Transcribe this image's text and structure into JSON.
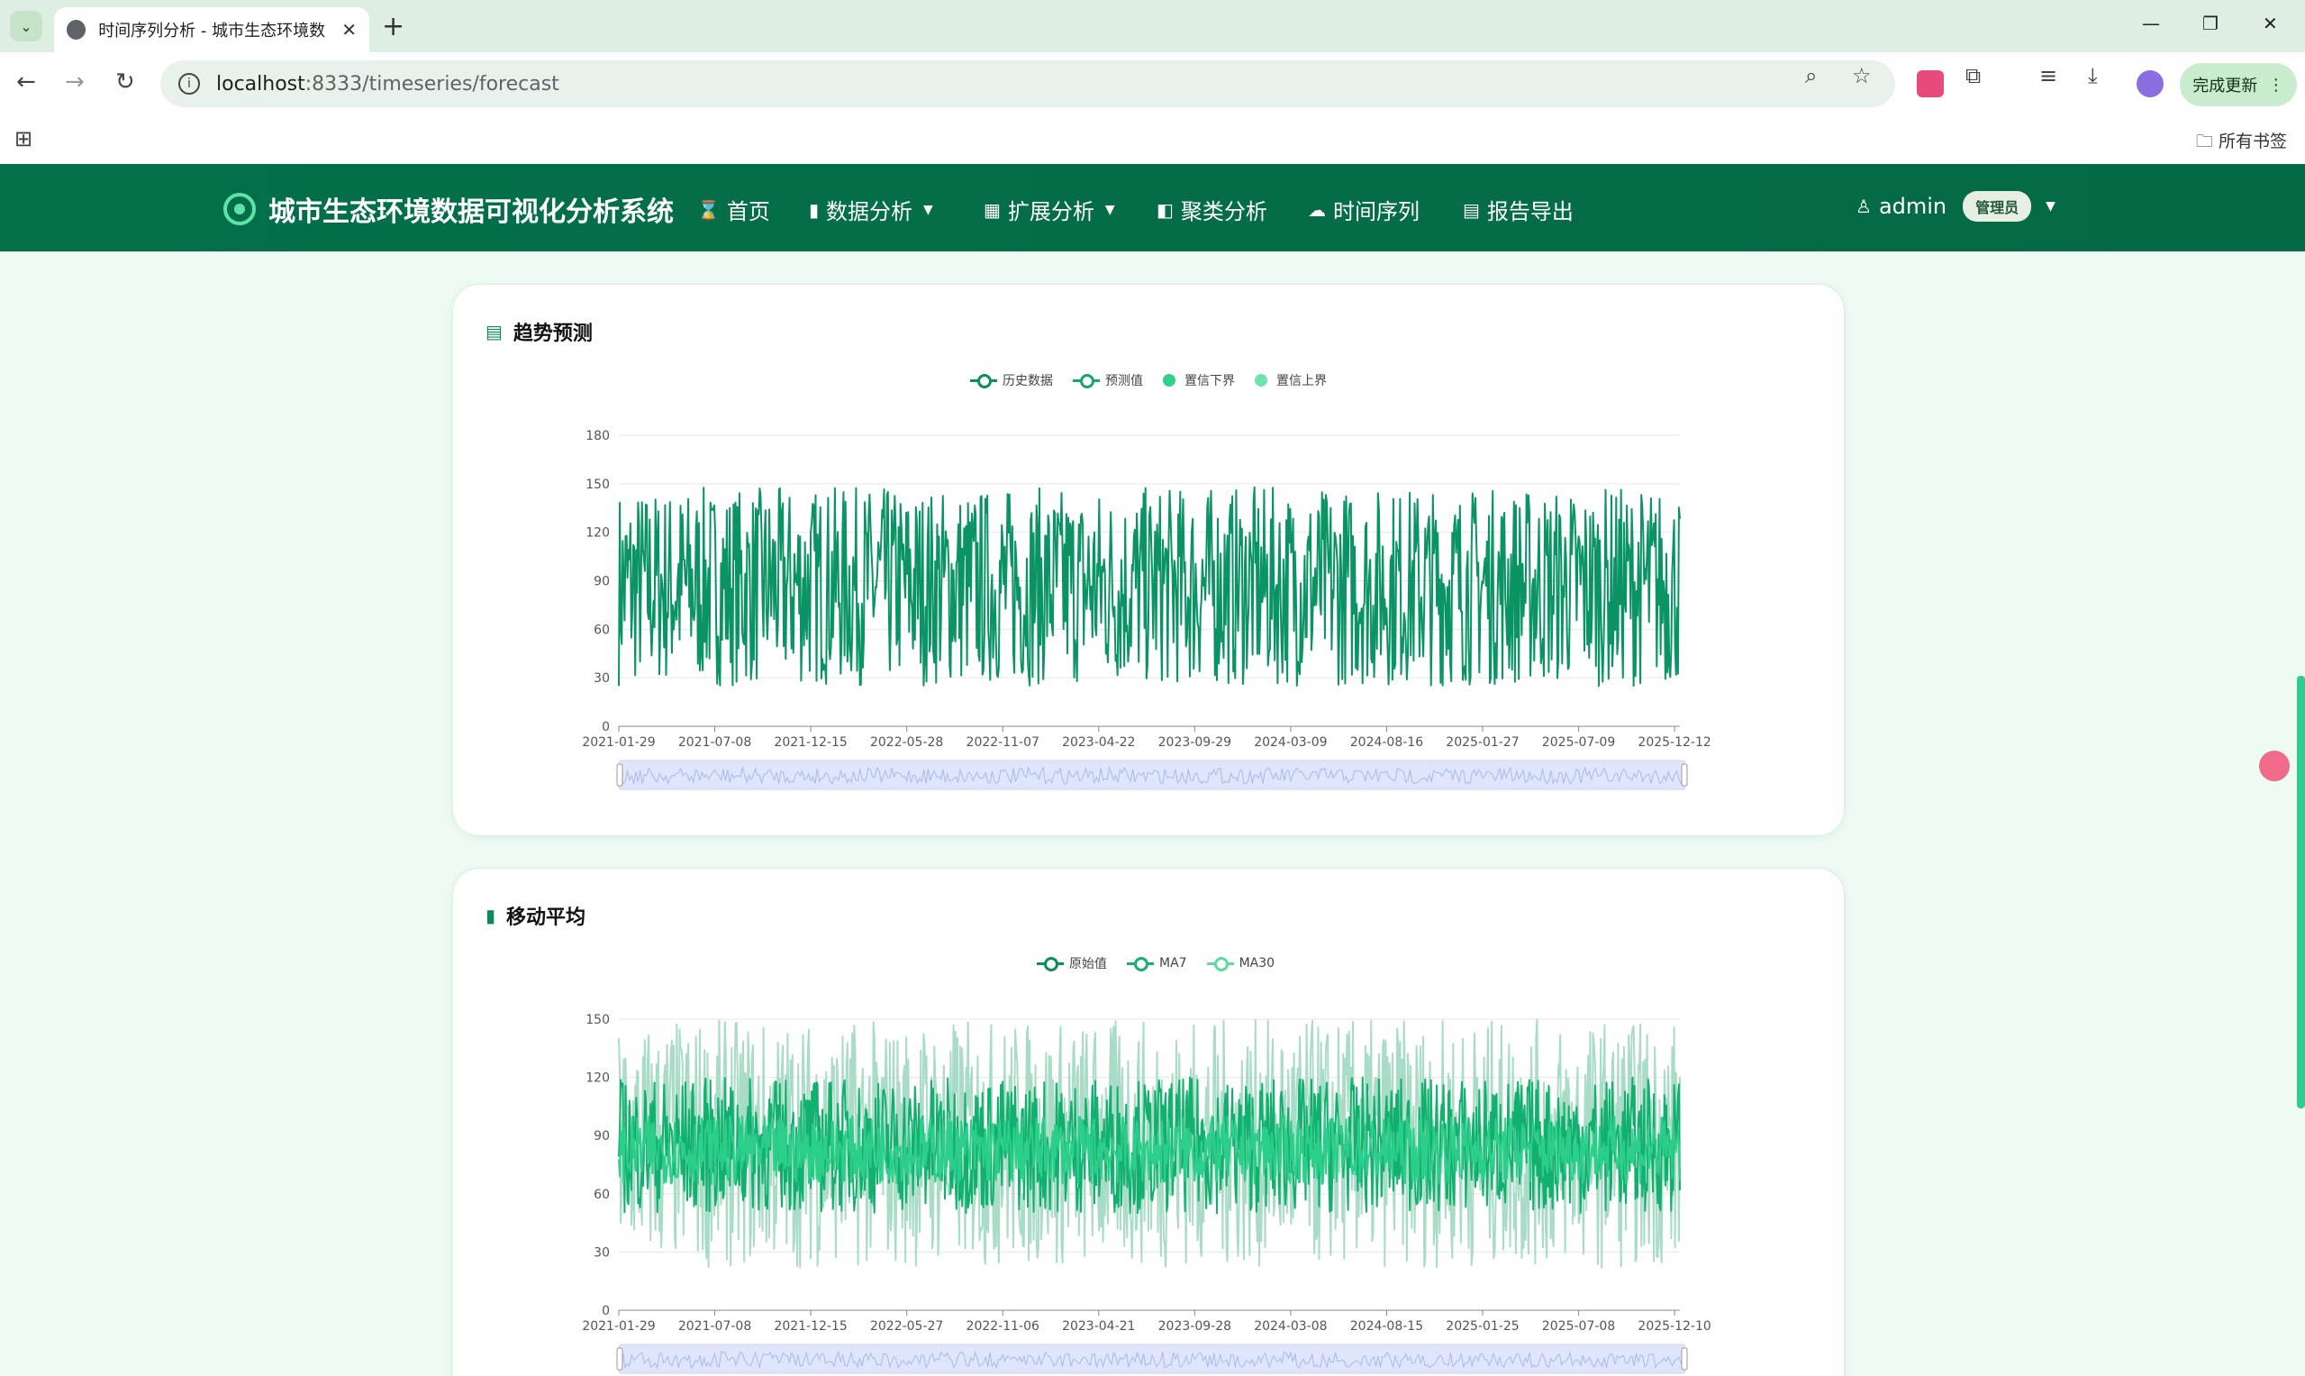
{
  "browser": {
    "tab_title": "时间序列分析 - 城市生态环境数",
    "url_host": "localhost",
    "url_rest": ":8333/timeseries/forecast",
    "update_label": "完成更新",
    "bookmarks_label": "所有书签",
    "icons": [
      "tab-search-icon",
      "back-icon",
      "forward-icon",
      "reload-icon",
      "info-icon",
      "zoom-icon",
      "star-icon",
      "extensions-icon",
      "download-icon",
      "profile-icon",
      "apps-icon",
      "folder-icon"
    ]
  },
  "nav": {
    "brand": "城市生态环境数据可视化分析系统",
    "items": [
      {
        "label": "首页",
        "icon": "hourglass-icon",
        "dropdown": false
      },
      {
        "label": "数据分析",
        "icon": "bar-chart-icon",
        "dropdown": true
      },
      {
        "label": "扩展分析",
        "icon": "grid-icon",
        "dropdown": true
      },
      {
        "label": "聚类分析",
        "icon": "layout-icon",
        "dropdown": false
      },
      {
        "label": "时间序列",
        "icon": "cloud-icon",
        "dropdown": false
      },
      {
        "label": "报告导出",
        "icon": "document-icon",
        "dropdown": false
      }
    ],
    "user": "admin",
    "role": "管理员"
  },
  "cards": [
    {
      "title": "趋势预测",
      "icon": "table-icon",
      "legend": [
        {
          "label": "历史数据",
          "kind": "line",
          "color": "#0a8f5a"
        },
        {
          "label": "预测值",
          "kind": "line",
          "color": "#16a66a"
        },
        {
          "label": "置信下界",
          "kind": "dot",
          "color": "#2fcf8c"
        },
        {
          "label": "置信上界",
          "kind": "dot",
          "color": "#6fe2b0"
        }
      ]
    },
    {
      "title": "移动平均",
      "icon": "bar-chart-icon",
      "legend": [
        {
          "label": "原始值",
          "kind": "line",
          "color": "#0a8f5a"
        },
        {
          "label": "MA7",
          "kind": "line",
          "color": "#16b070"
        },
        {
          "label": "MA30",
          "kind": "line",
          "color": "#5fd8a4"
        }
      ]
    }
  ],
  "chart_data": [
    {
      "type": "line",
      "title": "趋势预测",
      "x_ticks": [
        "2021-01-29",
        "2021-07-08",
        "2021-12-15",
        "2022-05-28",
        "2022-11-07",
        "2023-04-22",
        "2023-09-29",
        "2024-03-09",
        "2024-08-16",
        "2025-01-27",
        "2025-07-09",
        "2025-12-12"
      ],
      "y_ticks": [
        0,
        30,
        60,
        90,
        120,
        150,
        180
      ],
      "ylim": [
        0,
        180
      ],
      "series": [
        {
          "name": "历史数据",
          "band": [
            25,
            148
          ],
          "color": "#0a9463"
        }
      ],
      "data_zoom": true
    },
    {
      "type": "line",
      "title": "移动平均",
      "x_ticks": [
        "2021-01-29",
        "2021-07-08",
        "2021-12-15",
        "2022-05-27",
        "2022-11-06",
        "2023-04-21",
        "2023-09-28",
        "2024-03-08",
        "2024-08-15",
        "2025-01-25",
        "2025-07-08",
        "2025-12-10"
      ],
      "y_ticks": [
        0,
        30,
        60,
        90,
        120,
        150
      ],
      "ylim": [
        0,
        150
      ],
      "series": [
        {
          "name": "原始值",
          "band": [
            22,
            150
          ],
          "color": "#a9dcc6"
        },
        {
          "name": "MA7",
          "band": [
            50,
            120
          ],
          "color": "#12b06e"
        },
        {
          "name": "MA30",
          "band": [
            65,
            100
          ],
          "color": "#2ccf8a"
        }
      ],
      "data_zoom": true
    }
  ]
}
